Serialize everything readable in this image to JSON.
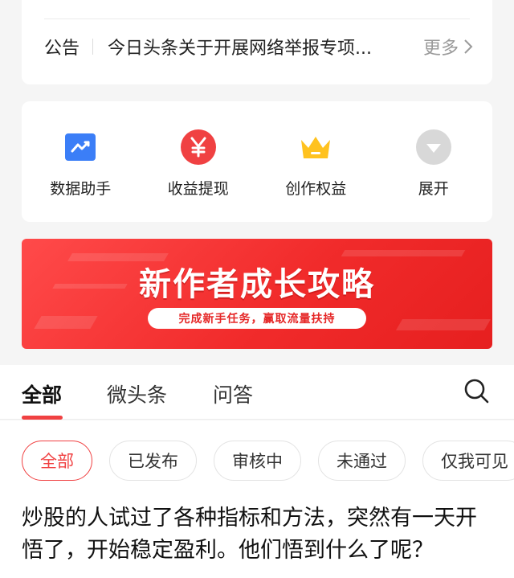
{
  "notice": {
    "label": "公告",
    "text": "今日头条关于开展网络举报专项...",
    "more": "更多"
  },
  "quick_actions": [
    {
      "label": "数据助手",
      "icon": "chart-trend-icon",
      "color": "#3b7ef7"
    },
    {
      "label": "收益提现",
      "icon": "yuan-icon",
      "color": "#f04142"
    },
    {
      "label": "创作权益",
      "icon": "crown-icon",
      "color": "#ffc21f"
    },
    {
      "label": "展开",
      "icon": "expand-down-icon",
      "color": "#d8d8d8"
    }
  ],
  "banner": {
    "title": "新作者成长攻略",
    "subtitle": "完成新手任务，赢取流量扶持"
  },
  "tabs": [
    {
      "label": "全部",
      "active": true
    },
    {
      "label": "微头条",
      "active": false
    },
    {
      "label": "问答",
      "active": false
    }
  ],
  "filters": [
    {
      "label": "全部",
      "active": true
    },
    {
      "label": "已发布",
      "active": false
    },
    {
      "label": "审核中",
      "active": false
    },
    {
      "label": "未通过",
      "active": false
    },
    {
      "label": "仅我可见",
      "active": false
    }
  ],
  "article": {
    "title": "炒股的人试过了各种指标和方法，突然有一天开悟了，开始稳定盈利。他们悟到什么了呢？"
  },
  "colors": {
    "accent": "#f04142",
    "banner_red": "#f12b2b"
  }
}
